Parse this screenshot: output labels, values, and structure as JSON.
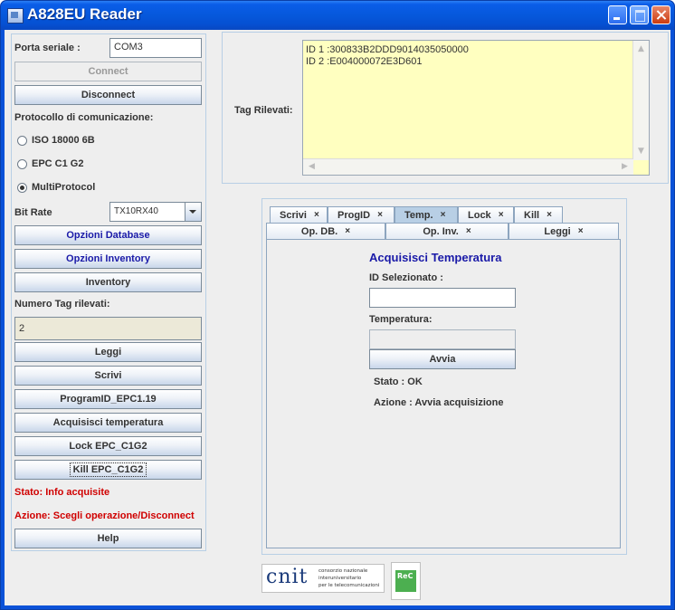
{
  "window": {
    "title": "A828EU Reader"
  },
  "left": {
    "porta_label": "Porta seriale :",
    "porta_value": "COM3",
    "connect": "Connect",
    "disconnect": "Disconnect",
    "protocollo_label": "Protocollo di comunicazione:",
    "radios": [
      {
        "label": "ISO 18000 6B",
        "selected": false
      },
      {
        "label": "EPC C1 G2",
        "selected": false
      },
      {
        "label": "MultiProtocol",
        "selected": true
      }
    ],
    "bitrate_label": "Bit Rate",
    "bitrate_value": "TX10RX40",
    "opzioni_database": "Opzioni Database",
    "opzioni_inventory": "Opzioni Inventory",
    "inventory": "Inventory",
    "numero_label": "Numero Tag rilevati:",
    "numero_value": "2",
    "leggi": "Leggi",
    "scrivi": "Scrivi",
    "programid": "ProgramID_EPC1.19",
    "acquisisci": "Acquisisci temperatura",
    "lock": "Lock  EPC_C1G2",
    "kill": "Kill EPC_C1G2",
    "stato": "Stato: Info acquisite",
    "azione": "Azione: Scegli operazione/Disconnect",
    "help": "Help"
  },
  "tags": {
    "label": "Tag Rilevati:",
    "lines": [
      "ID 1 :300833B2DDD9014035050000",
      "ID 2 :E004000072E3D601"
    ]
  },
  "tabs": {
    "row1": [
      {
        "label": "Scrivi",
        "close": "×"
      },
      {
        "label": "ProgID",
        "close": "×"
      },
      {
        "label": "Temp.",
        "close": "×"
      },
      {
        "label": "Lock",
        "close": "×"
      },
      {
        "label": "Kill",
        "close": "×"
      }
    ],
    "row2": [
      {
        "label": "Op. DB.",
        "close": "×"
      },
      {
        "label": "Op. Inv.",
        "close": "×"
      },
      {
        "label": "Leggi",
        "close": "×"
      }
    ]
  },
  "temp_panel": {
    "title": "Acquisisci Temperatura",
    "id_label": "ID Selezionato :",
    "id_value": "",
    "temp_label": "Temperatura:",
    "temp_value": "",
    "avvia": "Avvia",
    "stato": "Stato : OK",
    "azione": "Azione : Avvia acquisizione"
  },
  "logos": {
    "cnit_mark": "cnit",
    "cnit_text": [
      "consorzio nazionale",
      "interuniversitario",
      "per le telecomunicazioni"
    ],
    "rec_text": "ReC"
  },
  "colors": {
    "accent": "#1a1aa8",
    "status_red": "#d00000",
    "tag_area": "#ffffc0"
  }
}
